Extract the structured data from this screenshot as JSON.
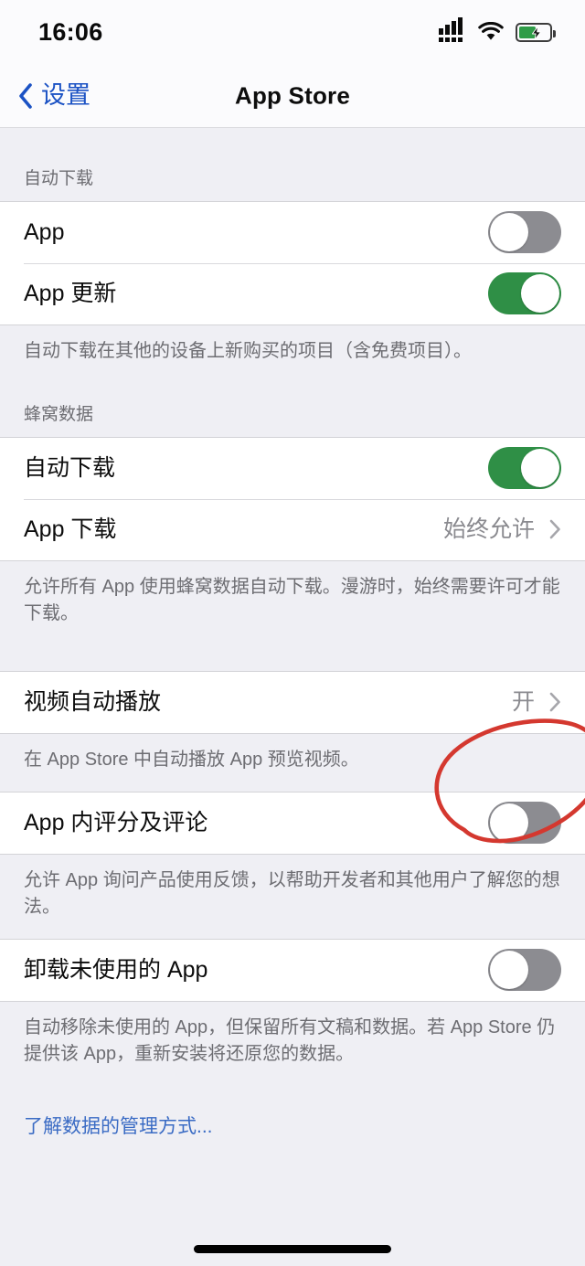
{
  "status_bar": {
    "time": "16:06",
    "signal_icon": "cellular-signal-icon",
    "wifi_icon": "wifi-icon",
    "battery_icon": "battery-charging-icon",
    "battery_level_percent": 56
  },
  "nav": {
    "back_label": "设置",
    "back_icon": "chevron-left-icon",
    "title": "App Store"
  },
  "sections": [
    {
      "header": "自动下载",
      "rows": [
        {
          "label": "App",
          "type": "toggle",
          "state": "off"
        },
        {
          "label": "App 更新",
          "type": "toggle",
          "state": "on"
        }
      ],
      "footer": "自动下载在其他的设备上新购买的项目（含免费项目）。"
    },
    {
      "header": "蜂窝数据",
      "rows": [
        {
          "label": "自动下载",
          "type": "toggle",
          "state": "on"
        },
        {
          "label": "App 下载",
          "type": "disclosure",
          "value": "始终允许"
        }
      ],
      "footer": "允许所有 App 使用蜂窝数据自动下载。漫游时，始终需要许可才能下载。"
    },
    {
      "header": "",
      "rows": [
        {
          "label": "视频自动播放",
          "type": "disclosure",
          "value": "开"
        }
      ],
      "footer": "在 App Store 中自动播放 App 预览视频。"
    },
    {
      "header": "",
      "rows": [
        {
          "label": "App 内评分及评论",
          "type": "toggle",
          "state": "off"
        }
      ],
      "footer": "允许 App 询问产品使用反馈，以帮助开发者和其他用户了解您的想法。"
    },
    {
      "header": "",
      "rows": [
        {
          "label": "卸载未使用的 App",
          "type": "toggle",
          "state": "off"
        }
      ],
      "footer": "自动移除未使用的 App，但保留所有文稿和数据。若 App Store 仍提供该 App，重新安装将还原您的数据。"
    }
  ],
  "link": {
    "label": "了解数据的管理方式..."
  },
  "annotation": {
    "shape": "hand-drawn-ellipse",
    "color": "#d4382f",
    "targets": "App 内评分及评论 开关"
  },
  "colors": {
    "toggle_on": "#2f8f46",
    "toggle_off": "#8c8c91",
    "tint_blue": "#1b52c4",
    "link_blue": "#3a6bc4",
    "group_background": "#efeff4"
  },
  "home_indicator": "home-indicator"
}
